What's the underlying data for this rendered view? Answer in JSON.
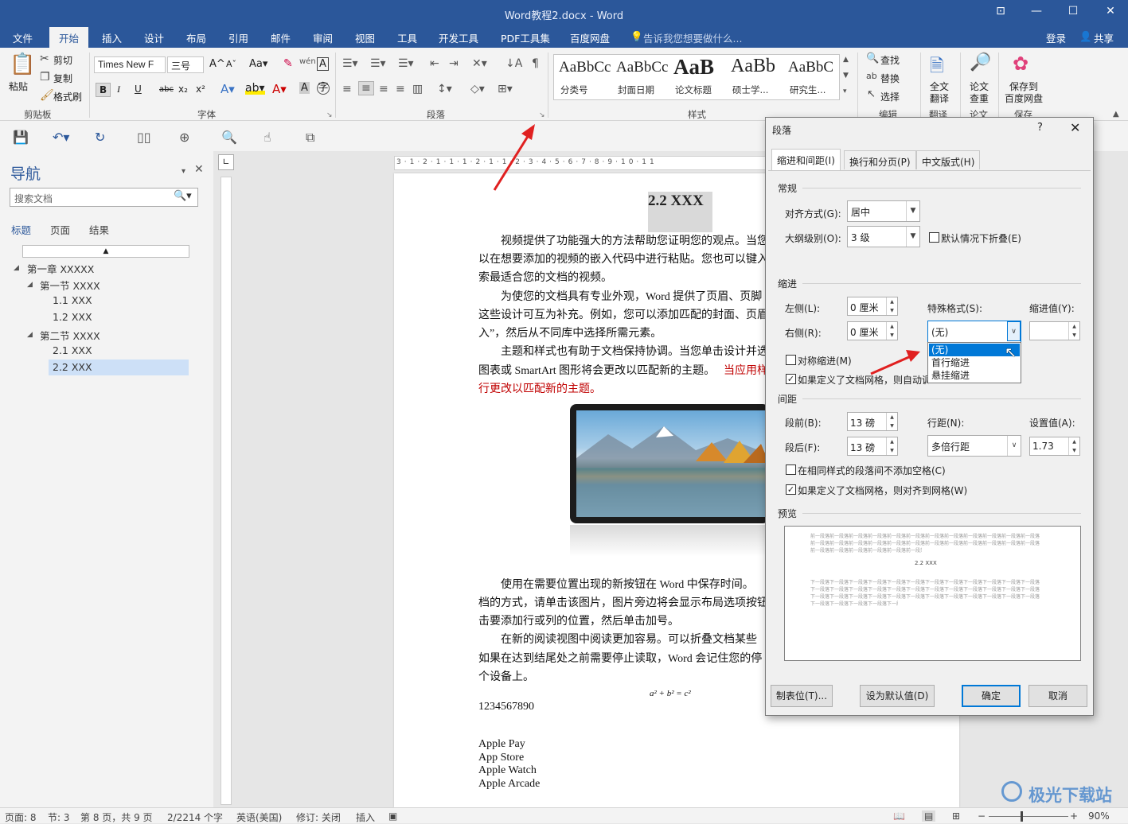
{
  "window": {
    "title": "Word教程2.docx - Word"
  },
  "tabs": [
    "文件",
    "开始",
    "插入",
    "设计",
    "布局",
    "引用",
    "邮件",
    "审阅",
    "视图",
    "工具",
    "开发工具",
    "PDF工具集",
    "百度网盘"
  ],
  "tell_me": "告诉我您想要做什么...",
  "login": "登录",
  "share": "共享",
  "clipboard": {
    "paste": "粘贴",
    "cut": "剪切",
    "copy": "复制",
    "format_painter": "格式刷",
    "group": "剪贴板"
  },
  "font": {
    "name": "Times New F",
    "size": "三号",
    "group": "字体",
    "bold": "B",
    "italic": "I",
    "underline": "U",
    "strike": "abc",
    "sub": "x₂",
    "sup": "x²"
  },
  "paragraph": {
    "group": "段落"
  },
  "styles": {
    "group": "样式",
    "items": [
      {
        "sample": "AaBbCc",
        "name": "分类号"
      },
      {
        "sample": "AaBbCc",
        "name": "封面日期"
      },
      {
        "sample": "AaB",
        "name": "论文标题"
      },
      {
        "sample": "AaBb",
        "name": "硕士学..."
      },
      {
        "sample": "AaBbC",
        "name": "研究生..."
      }
    ]
  },
  "editing": {
    "find": "查找",
    "replace": "替换",
    "select": "选择",
    "group": "编辑"
  },
  "translate": {
    "label1": "全文",
    "label2": "翻译",
    "group": "翻译"
  },
  "paper_check": {
    "label1": "论文",
    "label2": "查重",
    "group": "论文"
  },
  "baidu_save": {
    "label1": "保存到",
    "label2": "百度网盘",
    "group": "保存"
  },
  "nav": {
    "title": "导航",
    "search_placeholder": "搜索文档",
    "tabs": [
      "标题",
      "页面",
      "结果"
    ],
    "tree": [
      {
        "label": "第一章 XXXXX"
      },
      {
        "label": "第一节 XXXX"
      },
      {
        "label": "1.1 XXX"
      },
      {
        "label": "1.2 XXX"
      },
      {
        "label": "第二节 XXXX"
      },
      {
        "label": "2.1 XXX"
      },
      {
        "label": "2.2 XXX"
      }
    ]
  },
  "document": {
    "heading": "2.2 XXX",
    "lines": [
      "视频提供了功能强大的方法帮助您证明您的观点。当您",
      "以在想要添加的视频的嵌入代码中进行粘贴。您也可以键入",
      "索最适合您的文档的视频。",
      "为使您的文档具有专业外观，Word 提供了页眉、页脚",
      "这些设计可互为补充。例如，您可以添加匹配的封面、页眉",
      "入”，然后从不同库中选择所需元素。",
      "主题和样式也有助于文档保持协调。当您单击设计并选",
      "图表或 SmartArt 图形将会更改以匹配新的主题。",
      "当应用样",
      "行更改以匹配新的主题。",
      "使用在需要位置出现的新按钮在 Word 中保存时间。",
      "档的方式，请单击该图片，图片旁边将会显示布局选项按钮",
      "击要添加行或列的位置，然后单击加号。",
      "在新的阅读视图中阅读更加容易。可以折叠文档某些",
      "如果在达到结尾处之前需要停止读取，Word 会记住您的停",
      "个设备上。"
    ],
    "equation": "a² + b² = c²",
    "number": "1234567890",
    "apple": [
      "Apple Pay",
      "App Store",
      "Apple Watch",
      "Apple Arcade"
    ]
  },
  "status": {
    "page": "页面: 8",
    "section": "节: 3",
    "page_of": "第 8 页，共 9 页",
    "words": "2/2214 个字",
    "lang": "英语(美国)",
    "track": "修订: 关闭",
    "insert": "插入",
    "zoom": "90%"
  },
  "dialog": {
    "title": "段落",
    "help": "?",
    "tabs": [
      "缩进和间距(I)",
      "换行和分页(P)",
      "中文版式(H)"
    ],
    "general": "常规",
    "align_label": "对齐方式(G):",
    "align_value": "居中",
    "outline_label": "大纲级别(O):",
    "outline_value": "3 级",
    "collapse_label": "默认情况下折叠(E)",
    "indent": "缩进",
    "left_label": "左侧(L):",
    "left_value": "0 厘米",
    "right_label": "右侧(R):",
    "right_value": "0 厘米",
    "special_label": "特殊格式(S):",
    "special_value": "(无)",
    "indent_value_label": "缩进值(Y):",
    "mirror_label": "对称缩进(M)",
    "grid_indent_label": "如果定义了文档网格，则自动调",
    "dropdown": [
      "(无)",
      "首行缩进",
      "悬挂缩进"
    ],
    "spacing": "间距",
    "before_label": "段前(B):",
    "before_value": "13 磅",
    "after_label": "段后(F):",
    "after_value": "13 磅",
    "line_label": "行距(N):",
    "line_value": "多倍行距",
    "setting_label": "设置值(A):",
    "setting_value": "1.73",
    "no_space_label": "在相同样式的段落间不添加空格(C)",
    "snap_label": "如果定义了文档网格，则对齐到网格(W)",
    "preview": "预览",
    "preview_prev": "前一段落前一段落前一段落前一段落前一段落前一段落前一段落前一段落前一段落前一段落前一段落前一段落",
    "preview_heading": "2.2 XXX",
    "preview_next": "下一段落下一段落下一段落下一段落下一段落下一段落下一段落下一段落下一段落下一段落下一段落下一段落",
    "tabs_btn": "制表位(T)...",
    "default_btn": "设为默认值(D)",
    "ok_btn": "确定",
    "cancel_btn": "取消"
  },
  "watermark": "极光下载站"
}
